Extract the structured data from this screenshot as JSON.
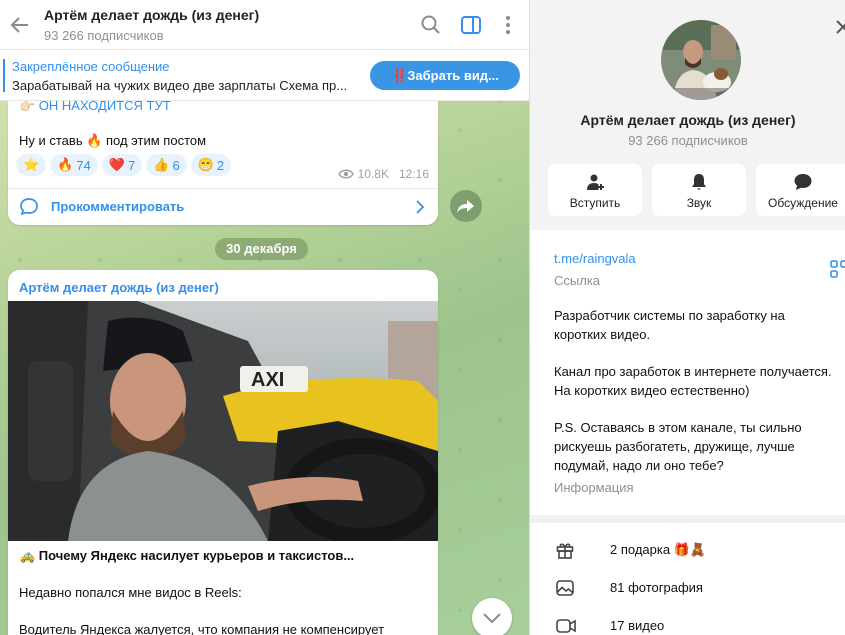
{
  "chat": {
    "title": "Артём делает дождь (из денег)",
    "subscribers": "93 266 подписчиков"
  },
  "pinned": {
    "title": "Закреплённое сообщение",
    "text": "Зарабатывай на чужих видео две зарплаты  Схема пр...",
    "button": "‼️Забрать вид..."
  },
  "post1": {
    "line1": "👉🏻 ОН НАХОДИТСЯ ТУТ",
    "line2": "Ну и ставь 🔥 под этим постом",
    "reactions": [
      {
        "emoji": "⭐",
        "count": ""
      },
      {
        "emoji": "🔥",
        "count": "74"
      },
      {
        "emoji": "❤️",
        "count": "7"
      },
      {
        "emoji": "👍",
        "count": "6"
      },
      {
        "emoji": "😁",
        "count": "2"
      }
    ],
    "views": "10.8K",
    "time": "12:16",
    "comment_label": "Прокомментировать"
  },
  "date_separator": "30 декабря",
  "post2": {
    "author": "Артём делает дождь (из денег)",
    "photo_sign": "AXI",
    "headline": "🚕 Почему Яндекс насилует курьеров и таксистов...",
    "p1": "Недавно попался мне видос в Reels:",
    "p2": "Водитель Яндекса жалуется, что компания не компенсирует"
  },
  "panel": {
    "title": "Артём делает дождь (из денег)",
    "subscribers": "93 266 подписчиков",
    "actions": [
      {
        "label": "Вступить",
        "icon": "add-user-icon"
      },
      {
        "label": "Звук",
        "icon": "bell-icon"
      },
      {
        "label": "Обсуждение",
        "icon": "chat-icon"
      }
    ],
    "link": "t.me/raingvala",
    "link_label": "Ссылка",
    "description": [
      "Разработчик системы по заработку на коротких видео.",
      "Канал про заработок в интернете получается. На коротких видео естественно)",
      "P.S. Оставаясь в этом канале, ты сильно рискуешь разбогатеть, дружище, лучше подумай, надо ли оно тебе?"
    ],
    "description_label": "Информация",
    "stats": [
      {
        "label": "2 подарка 🎁🧸",
        "icon": "gift-icon"
      },
      {
        "label": "81 фотография",
        "icon": "photo-icon"
      },
      {
        "label": "17 видео",
        "icon": "video-icon"
      }
    ]
  },
  "colors": {
    "accent": "#3390ec",
    "pinned_button": "#3a95e4",
    "reaction_bg": "#e8f2fc"
  }
}
